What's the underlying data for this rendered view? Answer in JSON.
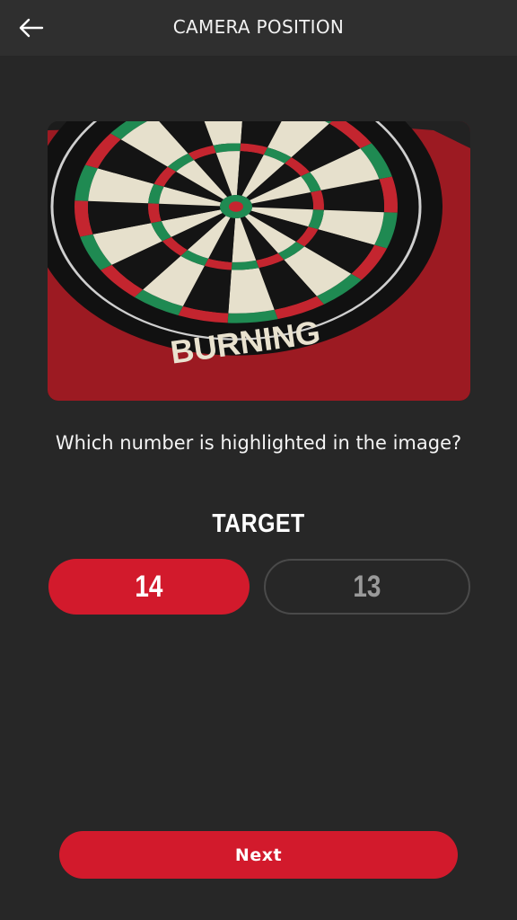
{
  "header": {
    "title": "CAMERA POSITION",
    "back_icon": "arrow-left-icon"
  },
  "image": {
    "description_icon": "dartboard-photo",
    "brand_text": "BURNING"
  },
  "question": "Which number is highlighted in the image?",
  "target": {
    "label": "TARGET",
    "options": [
      {
        "value": "14",
        "selected": true
      },
      {
        "value": "13",
        "selected": false
      }
    ]
  },
  "actions": {
    "next_label": "Next"
  },
  "colors": {
    "accent": "#d21a2c",
    "background": "#272727",
    "header": "#2f2f2f"
  }
}
